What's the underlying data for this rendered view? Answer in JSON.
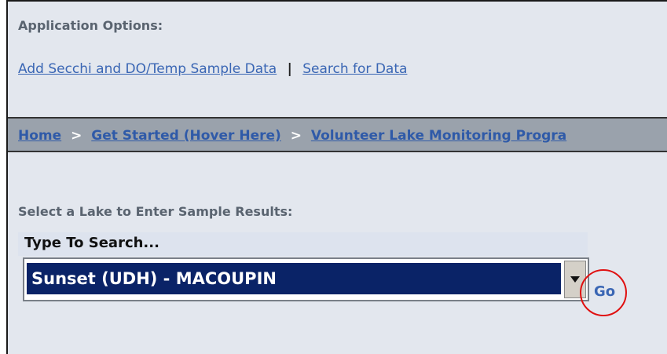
{
  "options": {
    "title": "Application Options:",
    "links": [
      "Add Secchi and DO/Temp Sample Data",
      "Search for Data"
    ],
    "separator": "|"
  },
  "breadcrumb": {
    "items": [
      "Home",
      "Get Started (Hover Here)",
      "Volunteer Lake Monitoring Progra"
    ],
    "separator": ">"
  },
  "lake_select": {
    "label": "Select a Lake to Enter Sample Results:",
    "search_label": "Type To Search...",
    "selected_value": "Sunset (UDH) - MACOUPIN",
    "go_label": "Go"
  },
  "colors": {
    "link": "#3a66b4",
    "selection_bg": "#0a2367",
    "highlight_circle": "#e01010",
    "panel_bg": "#e3e7ee"
  },
  "icons": {
    "dropdown": "chevron-down-icon"
  }
}
